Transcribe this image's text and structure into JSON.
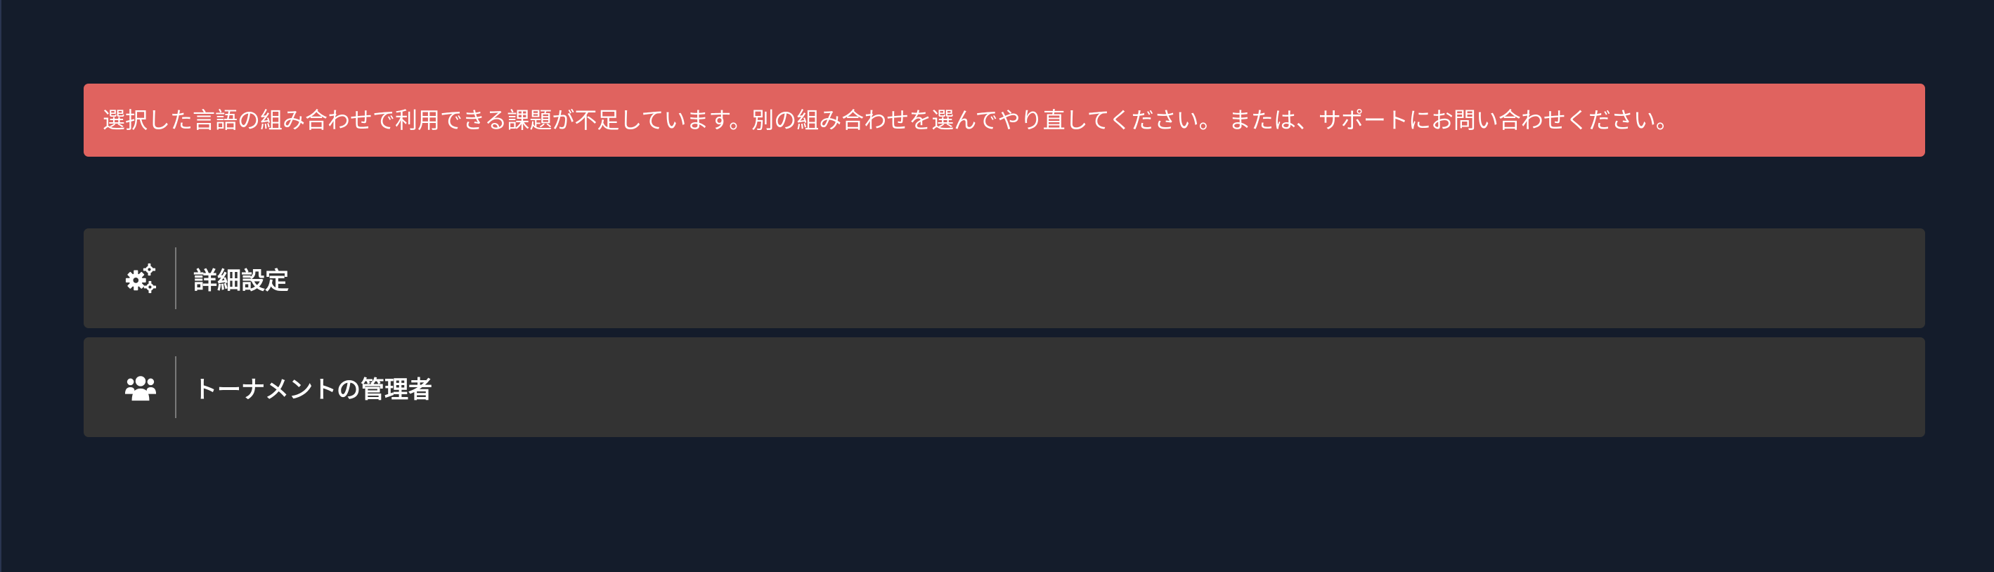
{
  "alert": {
    "message": "選択した言語の組み合わせで利用できる課題が不足しています。別の組み合わせを選んでやり直してください。 または、サポートにお問い合わせください。",
    "color": "#e0635f"
  },
  "panels": [
    {
      "label": "詳細設定",
      "icon": "gears-icon"
    },
    {
      "label": "トーナメントの管理者",
      "icon": "users-icon"
    }
  ],
  "colors": {
    "background": "#141c2b",
    "panel": "#333333",
    "text": "#ffffff"
  }
}
